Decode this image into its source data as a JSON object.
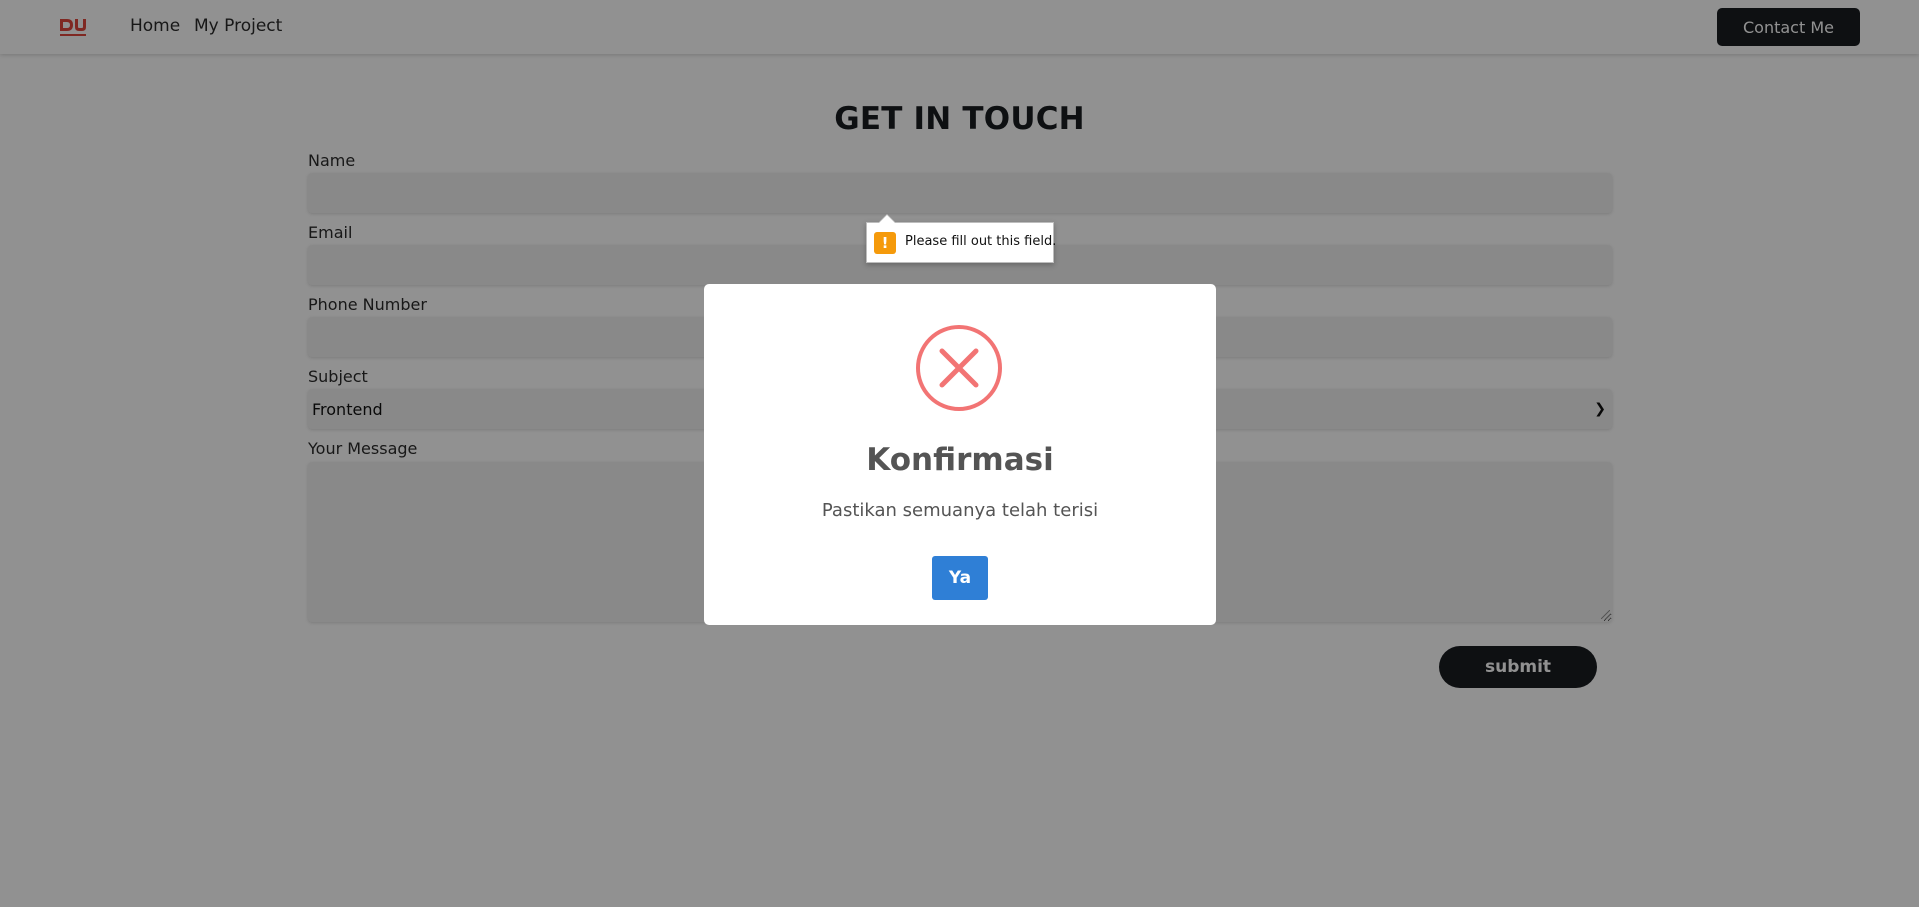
{
  "navbar": {
    "logo_text": "DU",
    "links": [
      "Home",
      "My Project"
    ],
    "contact_label": "Contact Me"
  },
  "form": {
    "title": "GET IN TOUCH",
    "name_label": "Name",
    "email_label": "Email",
    "phone_label": "Phone Number",
    "subject_label": "Subject",
    "subject_value": "Frontend",
    "message_label": "Your Message",
    "submit_label": "submit"
  },
  "tooltip": {
    "text": "Please fill out this field."
  },
  "modal": {
    "icon": "error-x-circle-icon",
    "title": "Konfirmasi",
    "text": "Pastikan semuanya telah terisi",
    "button_label": "Ya"
  },
  "colors": {
    "brand_red": "#e0473d",
    "dark": "#1a1d21",
    "modal_error": "#f27474",
    "modal_button": "#2f7fd6",
    "tooltip_warning": "#f59a0b"
  }
}
